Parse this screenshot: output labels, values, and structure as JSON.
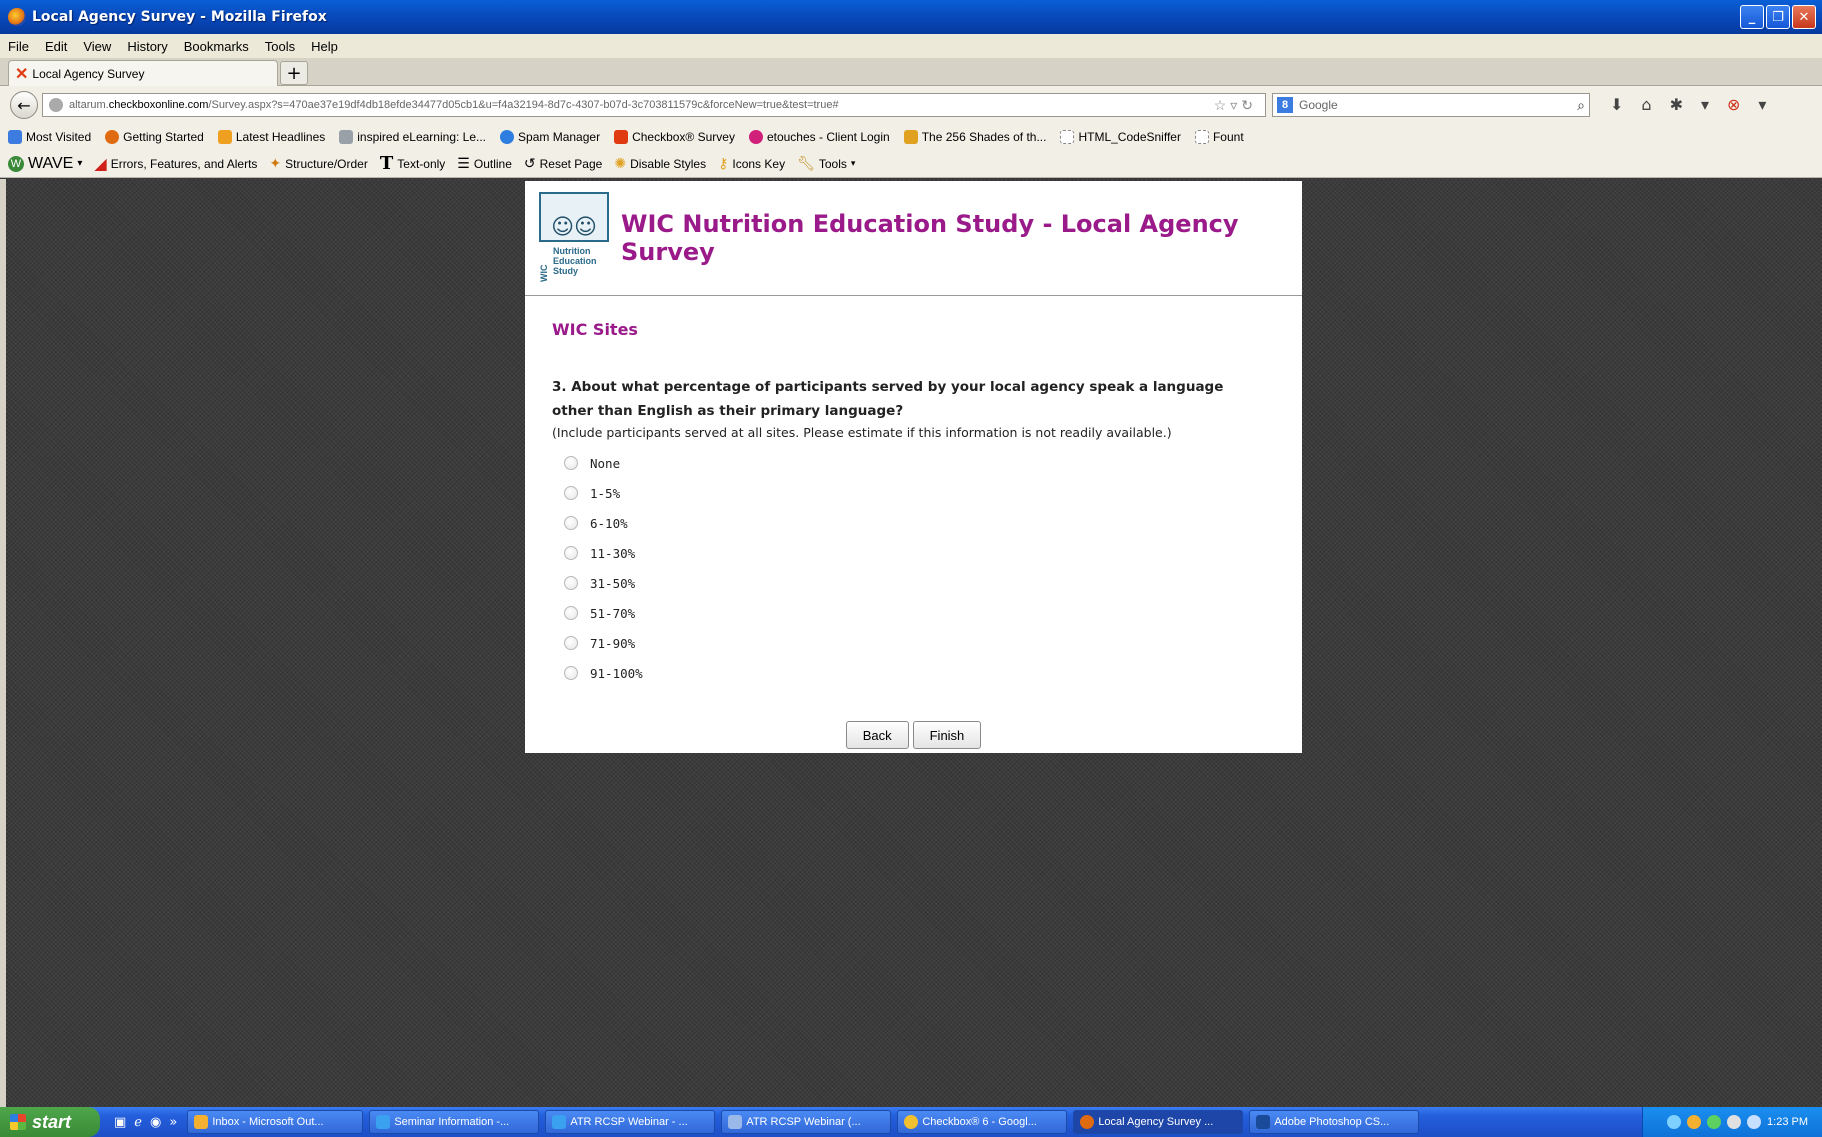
{
  "window": {
    "title": "Local Agency Survey - Mozilla Firefox",
    "controls": [
      "_",
      "❐",
      "✕"
    ]
  },
  "menu": [
    "File",
    "Edit",
    "View",
    "History",
    "Bookmarks",
    "Tools",
    "Help"
  ],
  "tab": {
    "label": "Local Agency Survey",
    "new_tab": "+"
  },
  "url": {
    "prefix": "altarum.",
    "domain": "checkboxonline.com",
    "path": "/Survey.aspx?s=470ae37e19df4db18efde34477d05cb1&u=f4a32194-8d7c-4307-b07d-3c703811579c&forceNew=true&test=true#"
  },
  "search": {
    "placeholder": "Google",
    "engine_letter": "8"
  },
  "bookmarks": [
    {
      "label": "Most Visited",
      "color": "#3c7ce0"
    },
    {
      "label": "Getting Started",
      "color": "#e06a10"
    },
    {
      "label": "Latest Headlines",
      "color": "#f0a020"
    },
    {
      "label": "inspired eLearning: Le...",
      "color": "#9aa0a8"
    },
    {
      "label": "Spam Manager",
      "color": "#2e7de0"
    },
    {
      "label": "Checkbox® Survey",
      "color": "#e03a10"
    },
    {
      "label": "etouches - Client Login",
      "color": "#d0207a"
    },
    {
      "label": "The 256 Shades of th...",
      "color": "#e0a020"
    },
    {
      "label": "HTML_CodeSniffer",
      "color": "#ffffff"
    },
    {
      "label": "Fount",
      "color": "#ffffff"
    }
  ],
  "wave": {
    "label": "WAVE",
    "items": [
      "Errors, Features, and Alerts",
      "Structure/Order",
      "Text-only",
      "Outline",
      "Reset Page",
      "Disable Styles",
      "Icons Key",
      "Tools"
    ]
  },
  "survey": {
    "header_title": "WIC Nutrition Education Study - Local Agency Survey",
    "logo_text": [
      "Nutrition",
      "Education",
      "Study"
    ],
    "logo_wic": "WIC",
    "section_title": "WIC Sites",
    "question": "3. About what percentage of participants served by your local agency speak a language other than English as their primary language?",
    "note": "(Include participants served at all sites. Please estimate if this information is not readily available.)",
    "options": [
      "None",
      "1-5%",
      "6-10%",
      "11-30%",
      "31-50%",
      "51-70%",
      "71-90%",
      "91-100%"
    ],
    "back_label": "Back",
    "finish_label": "Finish"
  },
  "taskbar": {
    "start_label": "start",
    "tasks": [
      {
        "label": "Inbox - Microsoft Out...",
        "active": false
      },
      {
        "label": "Seminar Information -...",
        "active": false
      },
      {
        "label": "ATR RCSP Webinar - ...",
        "active": false
      },
      {
        "label": "ATR RCSP Webinar (...",
        "active": false
      },
      {
        "label": "Checkbox® 6 - Googl...",
        "active": false
      },
      {
        "label": "Local Agency Survey ...",
        "active": true
      },
      {
        "label": "Adobe Photoshop CS...",
        "active": false
      }
    ],
    "clock": "1:23 PM"
  }
}
